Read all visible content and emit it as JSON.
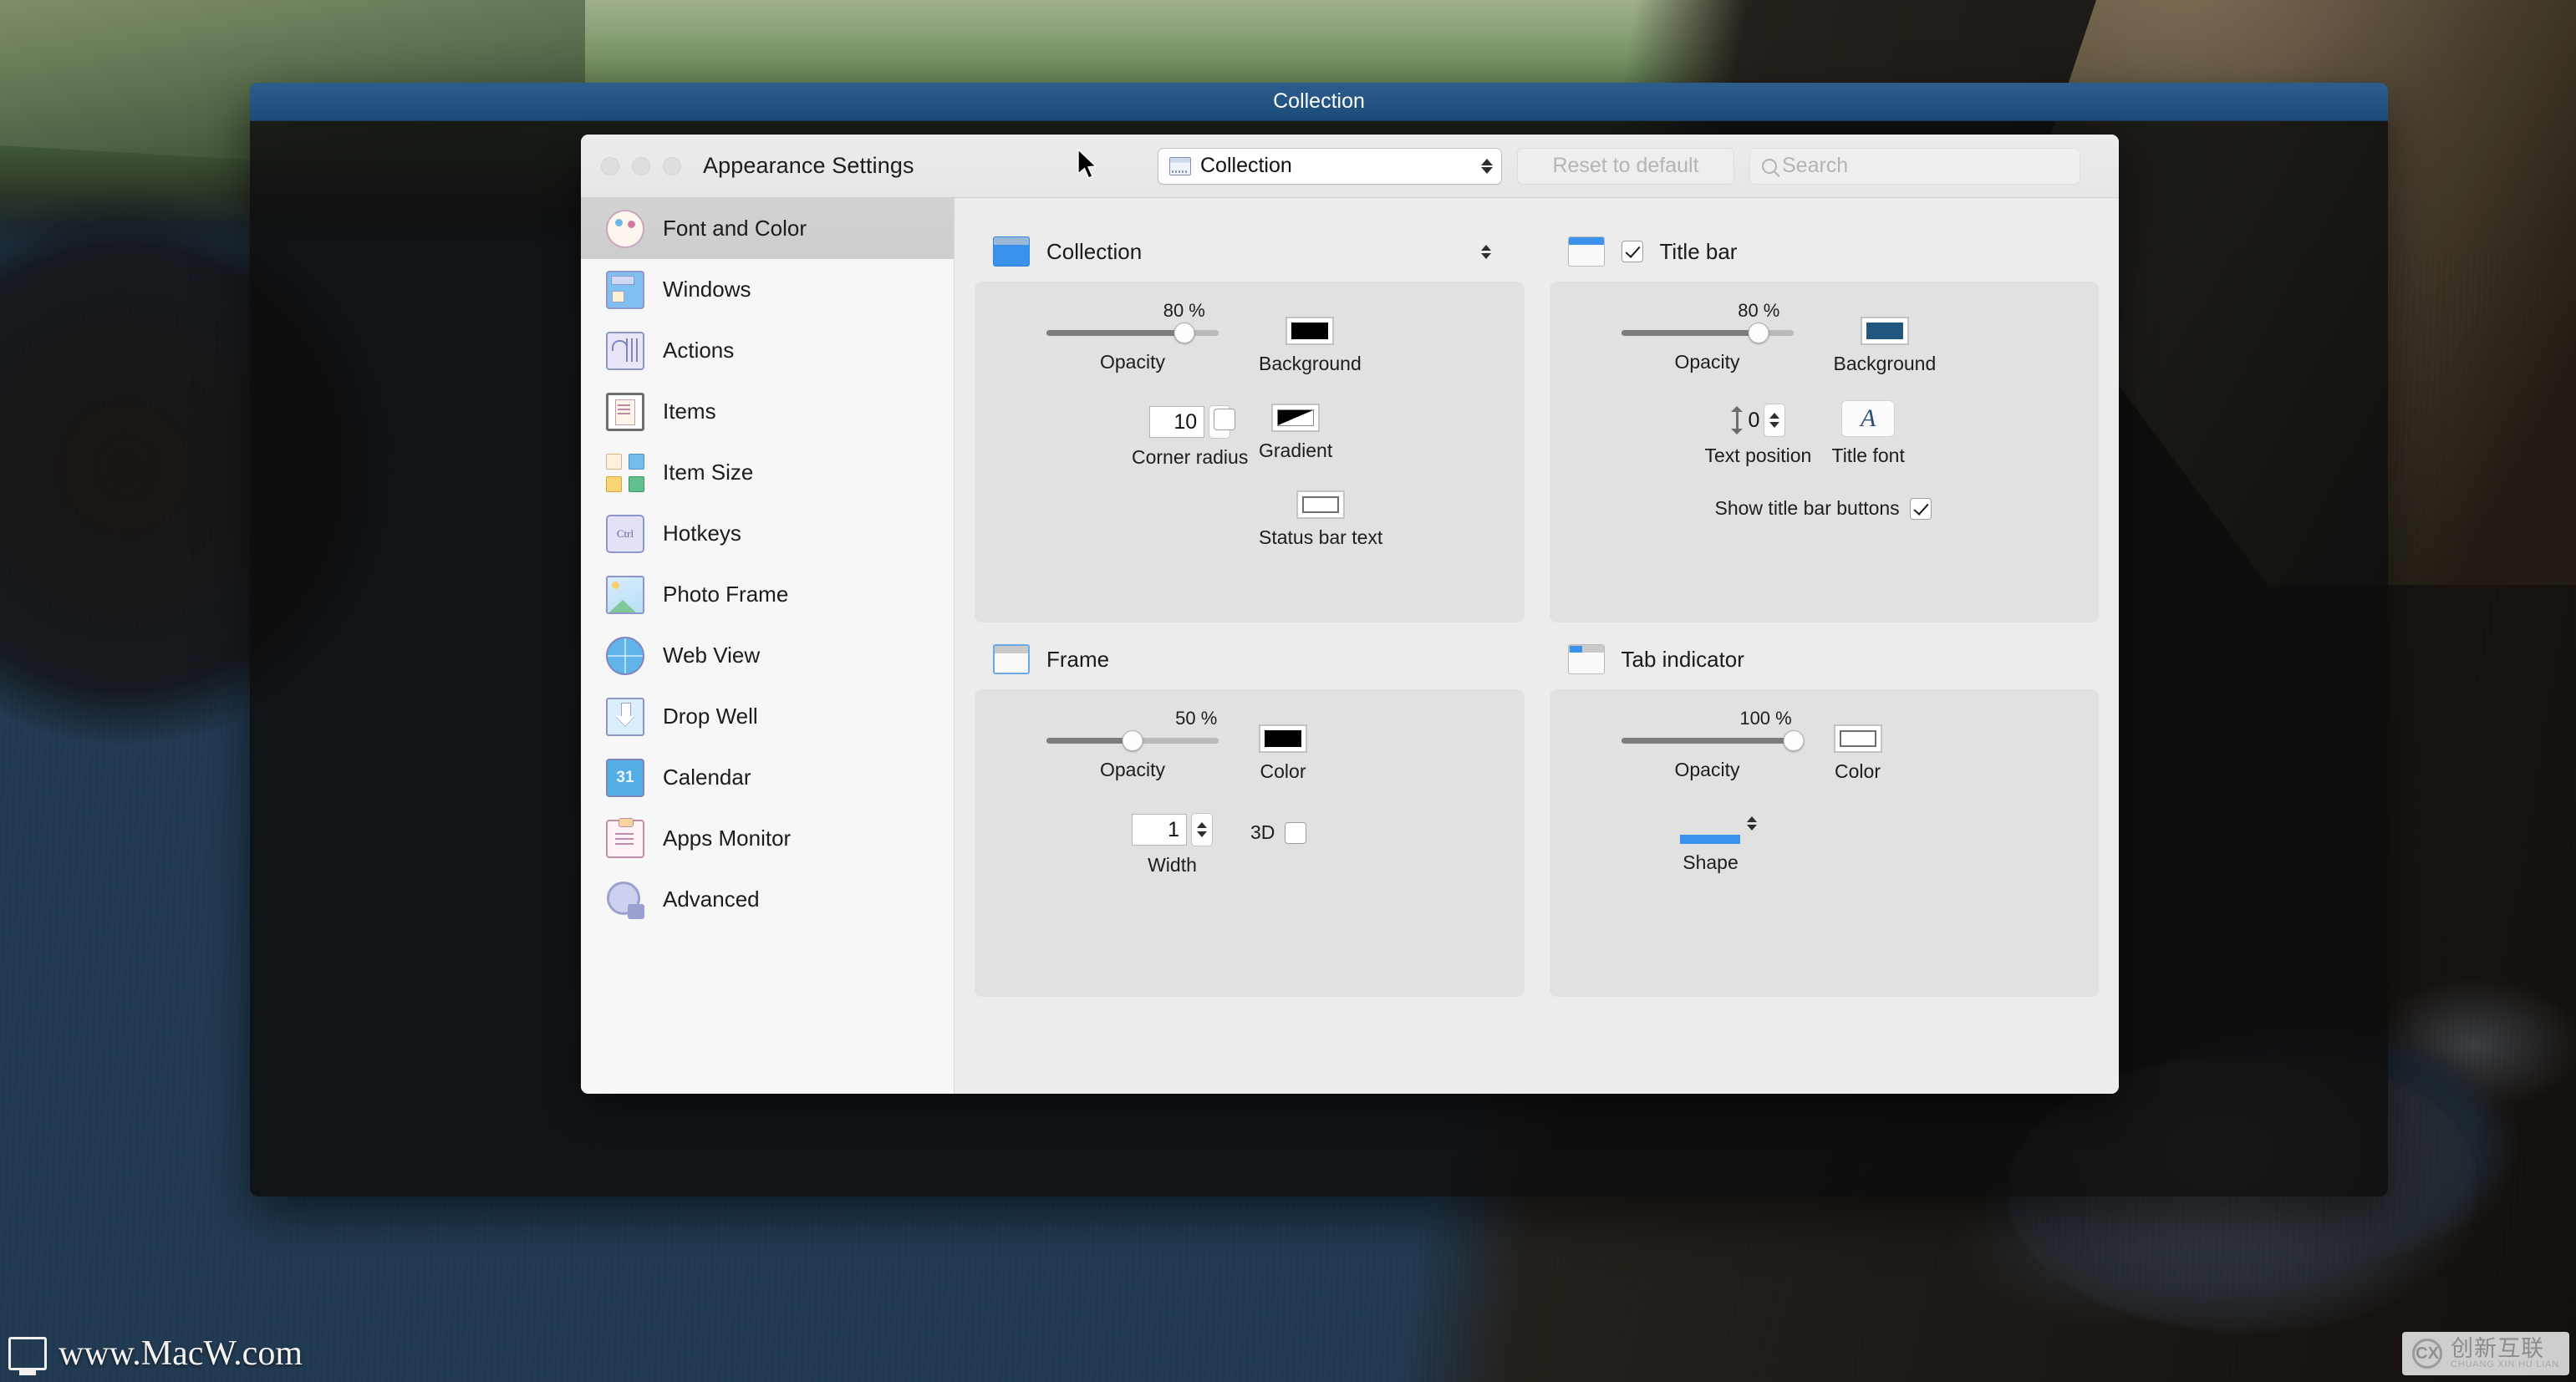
{
  "desktop": {
    "watermark_left": "www.MacW.com",
    "watermark_right_main": "创新互联",
    "watermark_right_sub": "CHUANG XIN HU LIAN",
    "watermark_right_logo": "CX"
  },
  "collection_window": {
    "title": "Collection"
  },
  "settings_window": {
    "title": "Appearance Settings",
    "toolbar": {
      "popup_value": "Collection",
      "reset_label": "Reset to default",
      "search_placeholder": "Search"
    },
    "sidebar": {
      "items": [
        {
          "label": "Font and Color",
          "icon": "palette-icon",
          "selected": true
        },
        {
          "label": "Windows",
          "icon": "windows-icon",
          "selected": false
        },
        {
          "label": "Actions",
          "icon": "sliders-icon",
          "selected": false
        },
        {
          "label": "Items",
          "icon": "document-icon",
          "selected": false
        },
        {
          "label": "Item Size",
          "icon": "grid-squares-icon",
          "selected": false
        },
        {
          "label": "Hotkeys",
          "icon": "ctrl-key-icon",
          "selected": false
        },
        {
          "label": "Photo Frame",
          "icon": "photo-icon",
          "selected": false
        },
        {
          "label": "Web View",
          "icon": "globe-cursor-icon",
          "selected": false
        },
        {
          "label": "Drop Well",
          "icon": "drop-arrow-icon",
          "selected": false
        },
        {
          "label": "Calendar",
          "icon": "calendar-31-icon",
          "selected": false
        },
        {
          "label": "Apps Monitor",
          "icon": "clipboard-icon",
          "selected": false
        },
        {
          "label": "Advanced",
          "icon": "gear-icon",
          "selected": false
        }
      ],
      "hotkeys_icon_text": "Ctrl",
      "calendar_icon_text": "31"
    },
    "groups": {
      "collection": {
        "title": "Collection",
        "opacity": {
          "label": "Opacity",
          "value": "80 %",
          "percent": 80
        },
        "background": {
          "label": "Background",
          "color": "#000000"
        },
        "corner_radius": {
          "label": "Corner radius",
          "value": "10"
        },
        "gradient": {
          "label": "Gradient",
          "enabled": false
        },
        "status_bar_text": {
          "label": "Status bar text",
          "color": "#ffffff"
        }
      },
      "title_bar": {
        "title": "Title bar",
        "enabled": true,
        "opacity": {
          "label": "Opacity",
          "value": "80 %",
          "percent": 80
        },
        "background": {
          "label": "Background",
          "color": "#23567f"
        },
        "text_position": {
          "label": "Text position",
          "value": "0"
        },
        "title_font": {
          "label": "Title font",
          "glyph": "A"
        },
        "show_buttons": {
          "label": "Show title bar buttons",
          "enabled": true
        }
      },
      "frame": {
        "title": "Frame",
        "opacity": {
          "label": "Opacity",
          "value": "50 %",
          "percent": 50
        },
        "color": {
          "label": "Color",
          "color": "#000000"
        },
        "width": {
          "label": "Width",
          "value": "1"
        },
        "three_d": {
          "label": "3D",
          "enabled": false
        }
      },
      "tab_indicator": {
        "title": "Tab indicator",
        "opacity": {
          "label": "Opacity",
          "value": "100 %",
          "percent": 100
        },
        "color": {
          "label": "Color",
          "color": "#ffffff"
        },
        "shape": {
          "label": "Shape"
        }
      }
    }
  }
}
